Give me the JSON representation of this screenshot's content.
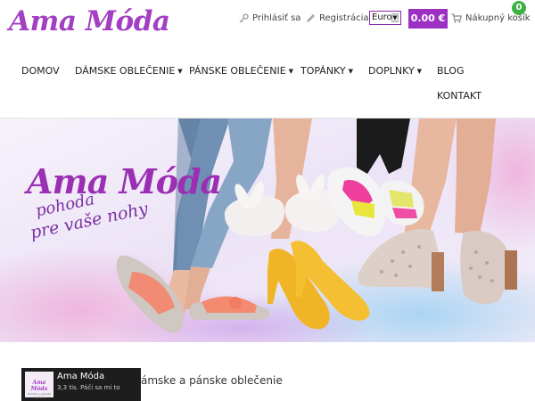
{
  "header": {
    "logo": "Ama Móda",
    "login_label": "Prihlásiť sa",
    "register_label": "Registrácia",
    "currency_selected": "Euro",
    "cart_price": "0.00 €",
    "cart_label": "Nákupný košík",
    "cart_count": "0"
  },
  "nav": {
    "items": [
      {
        "label": "DOMOV"
      },
      {
        "label": "DÁMSKE OBLEČENIE"
      },
      {
        "label": "PÁNSKE OBLEČENIE"
      },
      {
        "label": "TOPÁNKY"
      },
      {
        "label": "DOPLNKY"
      },
      {
        "label": "BLOG"
      },
      {
        "label": "KONTAKT"
      }
    ]
  },
  "hero": {
    "title": "Ama Móda",
    "subtitle_line1": "pohoda",
    "subtitle_line2": "pre vaše nohy"
  },
  "video": {
    "title": "Ama Móda",
    "meta": "3,3 tis. Páči sa mi to",
    "thumb_title": "Ama Móda",
    "thumb_sub": "Dámske a pánske oblečenie"
  },
  "content": {
    "caption": "ámske a pánske oblečenie"
  },
  "colors": {
    "brand": "#a23fc2",
    "price_bg": "#9b30c2",
    "badge": "#3bb143"
  }
}
